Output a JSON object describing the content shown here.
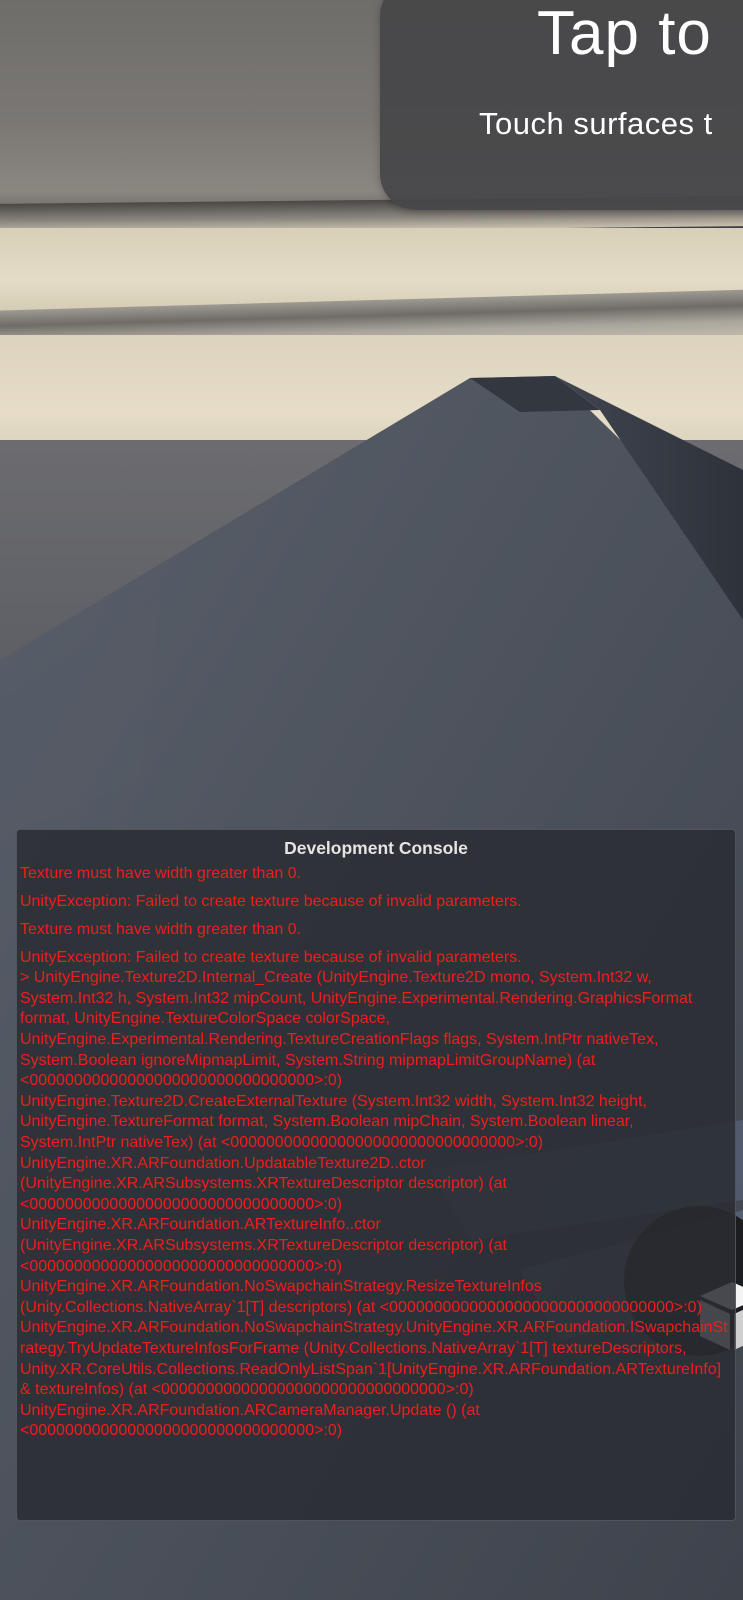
{
  "banner": {
    "title": "Tap to",
    "subtitle": "Touch surfaces t"
  },
  "place_button": {
    "icon": "cube-icon"
  },
  "console": {
    "title": "Development Console",
    "text_color": "#ef1e1e",
    "messages": [
      "Texture must have width greater than 0.",
      "UnityException: Failed to create texture because of invalid parameters.",
      "Texture must have width greater than 0."
    ],
    "exception": {
      "message": "UnityException: Failed to create texture because of invalid parameters.",
      "stack": [
        "> UnityEngine.Texture2D.Internal_Create (UnityEngine.Texture2D mono, System.Int32 w, System.Int32 h, System.Int32 mipCount, UnityEngine.Experimental.Rendering.GraphicsFormat format, UnityEngine.TextureColorSpace colorSpace, UnityEngine.Experimental.Rendering.TextureCreationFlags flags, System.IntPtr nativeTex, System.Boolean ignoreMipmapLimit, System.String mipmapLimitGroupName) (at <00000000000000000000000000000000>:0)",
        "UnityEngine.Texture2D.CreateExternalTexture (System.Int32 width, System.Int32 height, UnityEngine.TextureFormat format, System.Boolean mipChain, System.Boolean linear, System.IntPtr nativeTex) (at <00000000000000000000000000000000>:0)",
        "UnityEngine.XR.ARFoundation.UpdatableTexture2D..ctor (UnityEngine.XR.ARSubsystems.XRTextureDescriptor descriptor) (at <00000000000000000000000000000000>:0)",
        "UnityEngine.XR.ARFoundation.ARTextureInfo..ctor (UnityEngine.XR.ARSubsystems.XRTextureDescriptor descriptor) (at <00000000000000000000000000000000>:0)",
        "UnityEngine.XR.ARFoundation.NoSwapchainStrategy.ResizeTextureInfos (Unity.Collections.NativeArray`1[T] descriptors) (at <00000000000000000000000000000000>:0)",
        "UnityEngine.XR.ARFoundation.NoSwapchainStrategy.UnityEngine.XR.ARFoundation.ISwapchainStrategy.TryUpdateTextureInfosForFrame (Unity.Collections.NativeArray`1[T] textureDescriptors, Unity.XR.CoreUtils.Collections.ReadOnlyListSpan`1[UnityEngine.XR.ARFoundation.ARTextureInfo]& textureInfos) (at <00000000000000000000000000000000>:0)",
        "UnityEngine.XR.ARFoundation.ARCameraManager.Update () (at <00000000000000000000000000000000>:0)"
      ]
    }
  }
}
